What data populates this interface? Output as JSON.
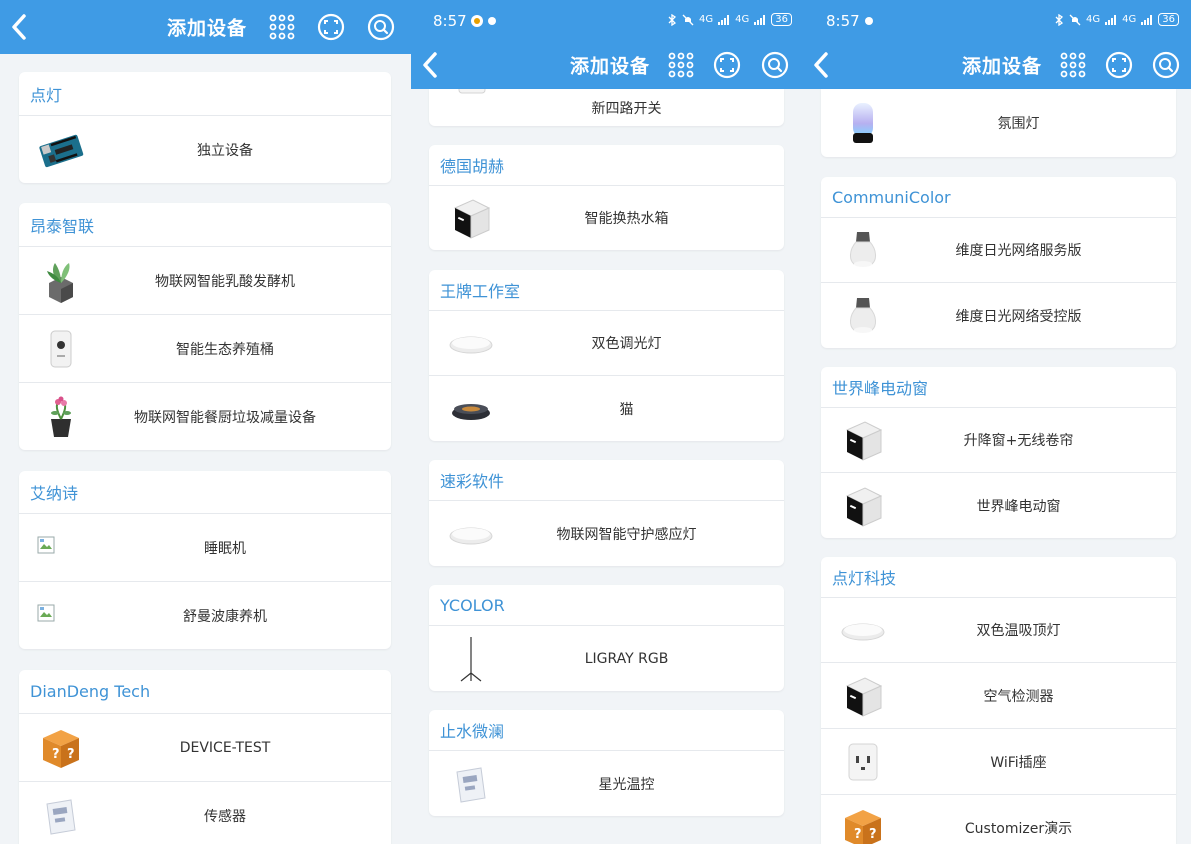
{
  "colors": {
    "accent": "#3f9be5",
    "section_title": "#3f93d6",
    "background": "#f1f4f7"
  },
  "header": {
    "title": "添加设备",
    "icons": [
      "back-icon",
      "grid-icon",
      "scan-icon",
      "search-icon"
    ]
  },
  "statusbar": {
    "time": "8:57",
    "signal_a": "4G",
    "signal_b": "4G",
    "battery": "36"
  },
  "panel1": {
    "sections": [
      {
        "title": "点灯",
        "items": [
          {
            "label": "独立设备",
            "icon": "arduino-board"
          }
        ]
      },
      {
        "title": "昂泰智联",
        "items": [
          {
            "label": "物联网智能乳酸发酵机",
            "icon": "plant-box"
          },
          {
            "label": "智能生态养殖桶",
            "icon": "white-box"
          },
          {
            "label": "物联网智能餐厨垃圾减量设备",
            "icon": "flower-pot"
          }
        ]
      },
      {
        "title": "艾纳诗",
        "items": [
          {
            "label": "睡眠机",
            "icon": "broken-image"
          },
          {
            "label": "舒曼波康养机",
            "icon": "broken-image"
          }
        ]
      },
      {
        "title": "DianDeng Tech",
        "items": [
          {
            "label": "DEVICE-TEST",
            "icon": "question-box"
          },
          {
            "label": "传感器",
            "icon": "thermo-display"
          }
        ]
      }
    ]
  },
  "panel2": {
    "sections": [
      {
        "title": "",
        "items": [
          {
            "label": "新四路开关",
            "icon": "socket"
          }
        ]
      },
      {
        "title": "德国胡赫",
        "items": [
          {
            "label": "智能换热水箱",
            "icon": "cube-display"
          }
        ]
      },
      {
        "title": "王牌工作室",
        "items": [
          {
            "label": "双色调光灯",
            "icon": "ceiling-light"
          },
          {
            "label": "猫",
            "icon": "robot-vacuum"
          }
        ]
      },
      {
        "title": "速彩软件",
        "items": [
          {
            "label": "物联网智能守护感应灯",
            "icon": "ceiling-light"
          }
        ]
      },
      {
        "title": "YCOLOR",
        "items": [
          {
            "label": "LIGRAY RGB",
            "icon": "tripod-lamp"
          }
        ]
      },
      {
        "title": "止水微澜",
        "items": [
          {
            "label": "星光温控",
            "icon": "thermo-display"
          }
        ]
      }
    ]
  },
  "panel3": {
    "sections": [
      {
        "title": "",
        "items": [
          {
            "label": "氛围灯",
            "icon": "mood-lamp"
          }
        ]
      },
      {
        "title": "CommuniColor",
        "items": [
          {
            "label": "维度日光网络服务版",
            "icon": "bulb"
          },
          {
            "label": "维度日光网络受控版",
            "icon": "bulb"
          }
        ]
      },
      {
        "title": "世界峰电动窗",
        "items": [
          {
            "label": "升降窗+无线卷帘",
            "icon": "cube-display"
          },
          {
            "label": "世界峰电动窗",
            "icon": "cube-display"
          }
        ]
      },
      {
        "title": "点灯科技",
        "items": [
          {
            "label": "双色温吸顶灯",
            "icon": "ceiling-light"
          },
          {
            "label": "空气检测器",
            "icon": "cube-display"
          },
          {
            "label": "WiFi插座",
            "icon": "socket"
          },
          {
            "label": "Customizer演示",
            "icon": "question-box"
          }
        ]
      }
    ]
  }
}
